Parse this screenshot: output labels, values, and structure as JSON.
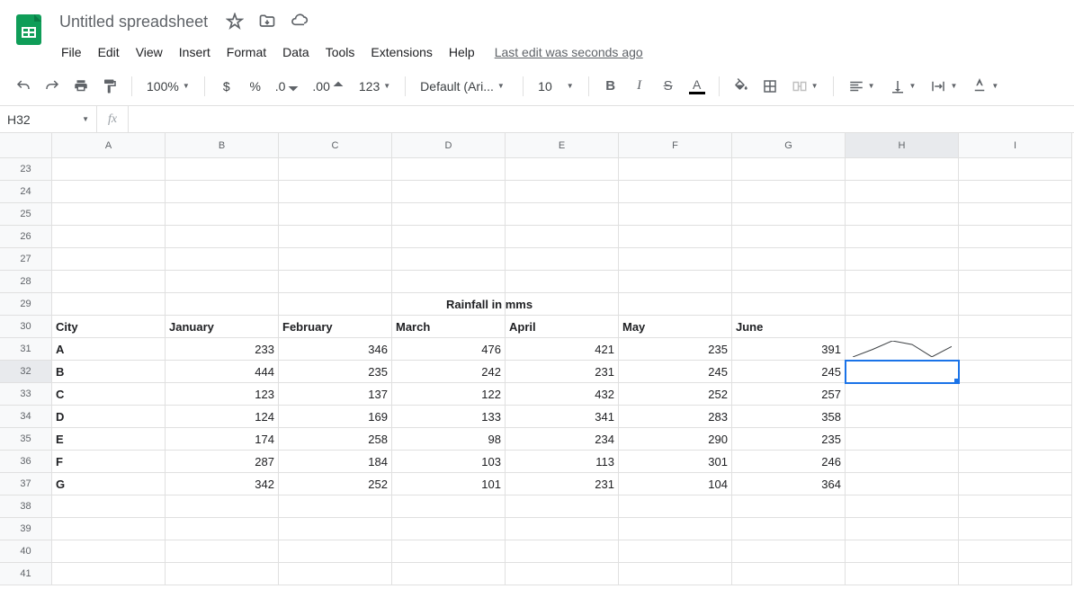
{
  "doc_title": "Untitled spreadsheet",
  "menu": [
    "File",
    "Edit",
    "View",
    "Insert",
    "Format",
    "Data",
    "Tools",
    "Extensions",
    "Help"
  ],
  "last_edit": "Last edit was seconds ago",
  "toolbar": {
    "zoom": "100%",
    "font": "Default (Ari...",
    "font_size": "10",
    "format_number": "123"
  },
  "name_box": "H32",
  "formula_value": "",
  "columns": [
    "A",
    "B",
    "C",
    "D",
    "E",
    "F",
    "G",
    "H",
    "I"
  ],
  "visible_row_start": 23,
  "visible_row_end": 41,
  "selected_cell": {
    "row": 32,
    "col": "H"
  },
  "sheet": {
    "title_row": 29,
    "title_col": "D_E_merged_visual",
    "title": "Rainfall in mms",
    "header_row": 30,
    "header_labels": {
      "A": "City",
      "B": "January",
      "C": "February",
      "D": "March",
      "E": "April",
      "F": "May",
      "G": "June"
    },
    "data_rows": [
      {
        "row": 31,
        "city": "A",
        "vals": [
          233,
          346,
          476,
          421,
          235,
          391
        ]
      },
      {
        "row": 32,
        "city": "B",
        "vals": [
          444,
          235,
          242,
          231,
          245,
          245
        ]
      },
      {
        "row": 33,
        "city": "C",
        "vals": [
          123,
          137,
          122,
          432,
          252,
          257
        ]
      },
      {
        "row": 34,
        "city": "D",
        "vals": [
          124,
          169,
          133,
          341,
          283,
          358
        ]
      },
      {
        "row": 35,
        "city": "E",
        "vals": [
          174,
          258,
          98,
          234,
          290,
          235
        ]
      },
      {
        "row": 36,
        "city": "F",
        "vals": [
          287,
          184,
          103,
          113,
          301,
          246
        ]
      },
      {
        "row": 37,
        "city": "G",
        "vals": [
          342,
          252,
          101,
          231,
          104,
          364
        ]
      }
    ],
    "sparkline_cell": {
      "row": 31,
      "col": "H",
      "series": [
        233,
        346,
        476,
        421,
        235,
        391
      ]
    }
  },
  "chart_data": {
    "type": "table",
    "title": "Rainfall in mms",
    "columns": [
      "City",
      "January",
      "February",
      "March",
      "April",
      "May",
      "June"
    ],
    "rows": [
      [
        "A",
        233,
        346,
        476,
        421,
        235,
        391
      ],
      [
        "B",
        444,
        235,
        242,
        231,
        245,
        245
      ],
      [
        "C",
        123,
        137,
        122,
        432,
        252,
        257
      ],
      [
        "D",
        124,
        169,
        133,
        341,
        283,
        358
      ],
      [
        "E",
        174,
        258,
        98,
        234,
        290,
        235
      ],
      [
        "F",
        287,
        184,
        103,
        113,
        301,
        246
      ],
      [
        "G",
        342,
        252,
        101,
        231,
        104,
        364
      ]
    ],
    "sparklines": [
      {
        "cell": "H31",
        "type": "line",
        "values": [
          233,
          346,
          476,
          421,
          235,
          391
        ]
      }
    ]
  }
}
